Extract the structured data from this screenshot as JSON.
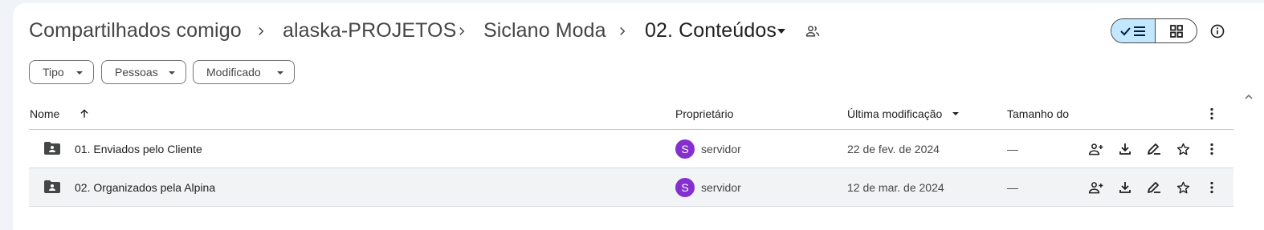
{
  "breadcrumb": {
    "items": [
      {
        "label": "Compartilhados comigo"
      },
      {
        "label": "alaska-PROJETOS"
      },
      {
        "label": "Siclano Moda"
      },
      {
        "label": "02. Conteúdos"
      }
    ],
    "separator": "›"
  },
  "view_toggle": {
    "active": "list"
  },
  "filters": [
    {
      "label": "Tipo"
    },
    {
      "label": "Pessoas"
    },
    {
      "label": "Modificado"
    }
  ],
  "table": {
    "columns": {
      "name": "Nome",
      "owner": "Proprietário",
      "modified": "Última modificação",
      "size": "Tamanho do"
    },
    "rows": [
      {
        "name": "01. Enviados pelo Cliente",
        "owner_initial": "S",
        "owner": "servidor",
        "modified": "22 de fev. de 2024",
        "size": "—"
      },
      {
        "name": "02. Organizados pela Alpina",
        "owner_initial": "S",
        "owner": "servidor",
        "modified": "12 de mar. de 2024",
        "size": "—"
      }
    ]
  },
  "colors": {
    "accent_selected": "#c2e7ff",
    "avatar": "#8430ce"
  }
}
